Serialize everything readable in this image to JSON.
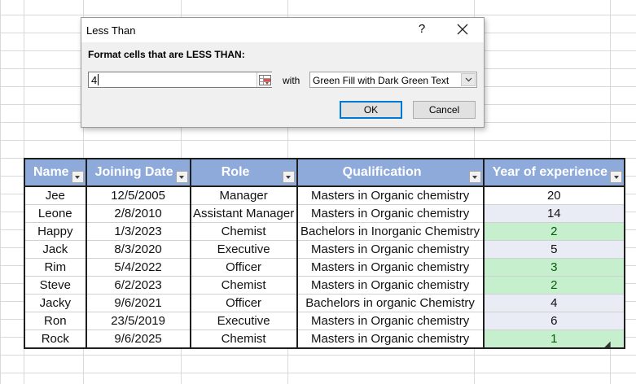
{
  "dialog": {
    "title": "Less Than",
    "help_label": "?",
    "prompt": "Format cells that are LESS THAN:",
    "input_value": "4",
    "with_label": "with",
    "format_selected": "Green Fill with Dark Green Text",
    "ok_label": "OK",
    "cancel_label": "Cancel"
  },
  "table": {
    "headers": [
      "Name",
      "Joining Date",
      "Role",
      "Qualification",
      "Year of experience"
    ],
    "rows": [
      [
        "Jee",
        "12/5/2005",
        "Manager",
        "Masters in Organic chemistry",
        "20"
      ],
      [
        "Leone",
        "2/8/2010",
        "Assistant Manager",
        "Masters in Organic chemistry",
        "14"
      ],
      [
        "Happy",
        "1/3/2023",
        "Chemist",
        "Bachelors in Inorganic Chemistry",
        "2"
      ],
      [
        "Jack",
        "8/3/2020",
        "Executive",
        "Masters in Organic chemistry",
        "5"
      ],
      [
        "Rim",
        "5/4/2022",
        "Officer",
        "Masters in Organic chemistry",
        "3"
      ],
      [
        "Steve",
        "6/2/2023",
        "Chemist",
        "Masters in Organic chemistry",
        "2"
      ],
      [
        "Jacky",
        "9/6/2021",
        "Officer",
        "Bachelors in organic Chemistry",
        "4"
      ],
      [
        "Ron",
        "23/5/2019",
        "Executive",
        "Masters in Organic chemistry",
        "6"
      ],
      [
        "Rock",
        "9/6/2025",
        "Chemist",
        "Masters in Organic chemistry",
        "1"
      ]
    ]
  },
  "colors": {
    "header_fill": "#8eaadb",
    "highlight_fill": "#c6efce",
    "highlight_text": "#006100",
    "column_band": "#e9ecf5",
    "ok_border": "#0078d7"
  }
}
